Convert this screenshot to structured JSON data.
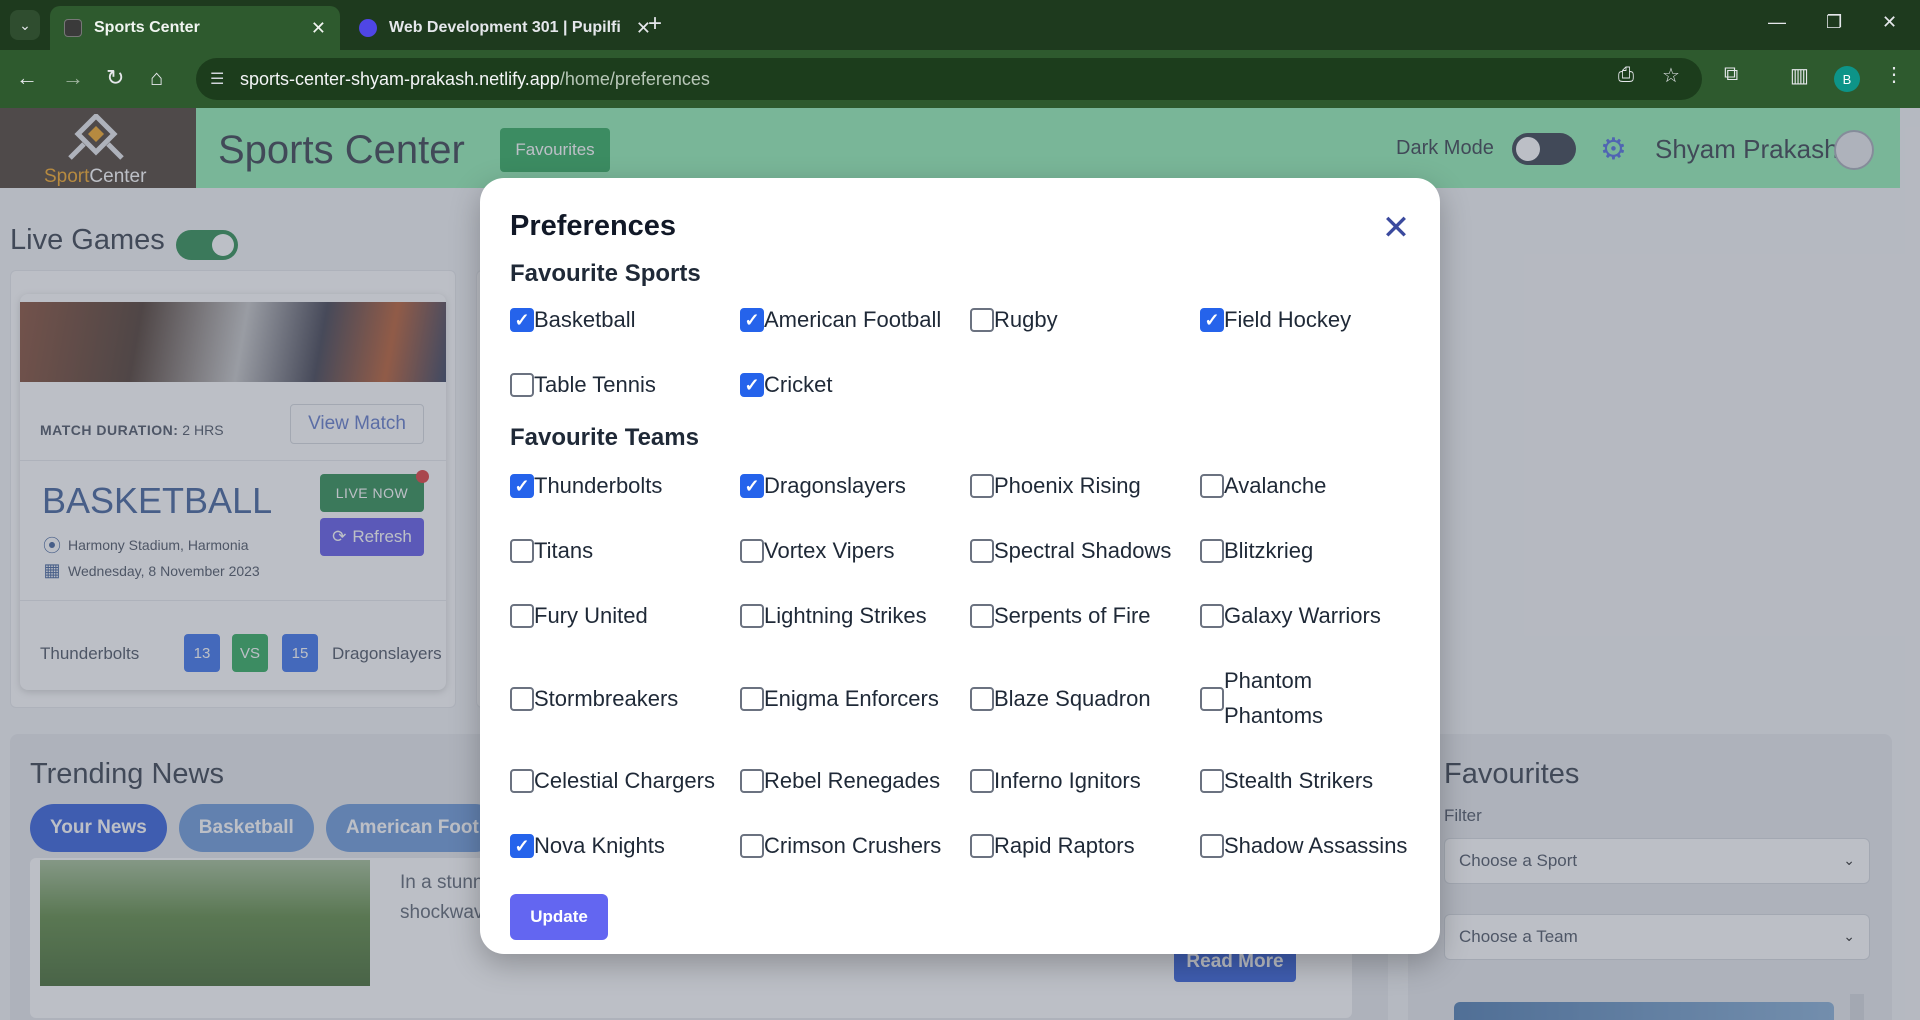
{
  "browser": {
    "tabs": [
      {
        "title": "Sports Center",
        "active": true
      },
      {
        "title": "Web Development 301 | Pupilfi",
        "active": false
      }
    ],
    "url_host": "sports-center-shyam-prakash.netlify.app",
    "url_path": "/home/preferences",
    "profile_initial": "B"
  },
  "header": {
    "logo_text_a": "Sport",
    "logo_text_b": "Center",
    "brand": "Sports Center",
    "favourites_button": "Favourites",
    "dark_mode_label": "Dark Mode",
    "dark_mode_on": false,
    "user_name": "Shyam Prakash"
  },
  "live_games": {
    "title": "Live Games",
    "toggle_on": true,
    "card": {
      "duration_label": "MATCH DURATION:",
      "duration_value": "2 HRS",
      "view_match": "View Match",
      "sport": "BASKETBALL",
      "live_now": "LIVE NOW",
      "refresh": "Refresh",
      "venue": "Harmony Stadium, Harmonia",
      "date": "Wednesday, 8 November 2023",
      "team_a": "Thunderbolts",
      "score_a": "13",
      "vs": "VS",
      "score_b": "15",
      "team_b": "Dragonslayers"
    }
  },
  "news": {
    "title": "Trending News",
    "tabs": [
      "Your News",
      "Basketball",
      "American Foot"
    ],
    "excerpt_line1": "In a stunn",
    "excerpt_line2": "shockwav",
    "read_more": "Read More"
  },
  "favourites_panel": {
    "title": "Favourites",
    "filter_label": "Filter",
    "sport_select": "Choose a Sport",
    "team_select": "Choose a Team"
  },
  "modal": {
    "title": "Preferences",
    "sports_title": "Favourite Sports",
    "sports": [
      {
        "label": "Basketball",
        "checked": true
      },
      {
        "label": "American Football",
        "checked": true
      },
      {
        "label": "Rugby",
        "checked": false
      },
      {
        "label": "Field Hockey",
        "checked": true
      },
      {
        "label": "Table Tennis",
        "checked": false
      },
      {
        "label": "Cricket",
        "checked": true
      }
    ],
    "teams_title": "Favourite Teams",
    "teams": [
      {
        "label": "Thunderbolts",
        "checked": true
      },
      {
        "label": "Dragonslayers",
        "checked": true
      },
      {
        "label": "Phoenix Rising",
        "checked": false
      },
      {
        "label": "Avalanche",
        "checked": false
      },
      {
        "label": "Titans",
        "checked": false
      },
      {
        "label": "Vortex Vipers",
        "checked": false
      },
      {
        "label": "Spectral Shadows",
        "checked": false
      },
      {
        "label": "Blitzkrieg",
        "checked": false
      },
      {
        "label": "Fury United",
        "checked": false
      },
      {
        "label": "Lightning Strikes",
        "checked": false
      },
      {
        "label": "Serpents of Fire",
        "checked": false
      },
      {
        "label": "Galaxy Warriors",
        "checked": false
      },
      {
        "label": "Stormbreakers",
        "checked": false
      },
      {
        "label": "Enigma Enforcers",
        "checked": false
      },
      {
        "label": "Blaze Squadron",
        "checked": false
      },
      {
        "label": "Phantom Phantoms",
        "checked": false
      },
      {
        "label": "Celestial Chargers",
        "checked": false
      },
      {
        "label": "Rebel Renegades",
        "checked": false
      },
      {
        "label": "Inferno Ignitors",
        "checked": false
      },
      {
        "label": "Stealth Strikers",
        "checked": false
      },
      {
        "label": "Nova Knights",
        "checked": true
      },
      {
        "label": "Crimson Crushers",
        "checked": false
      },
      {
        "label": "Rapid Raptors",
        "checked": false
      },
      {
        "label": "Shadow Assassins",
        "checked": false
      }
    ],
    "update_button": "Update"
  },
  "colors": {
    "header_green": "#86efac",
    "accent_blue": "#2563eb",
    "update_indigo": "#6366f1",
    "live_green": "#15803d"
  }
}
